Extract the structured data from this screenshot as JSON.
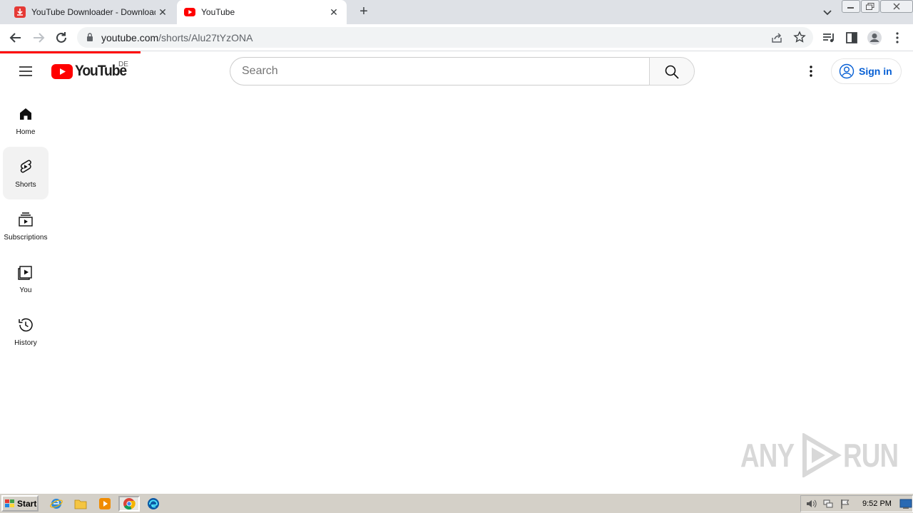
{
  "browser": {
    "tabs": [
      {
        "title": "YouTube Downloader - Download YouTube Videos",
        "active": false
      },
      {
        "title": "YouTube",
        "active": true
      }
    ],
    "address": {
      "host": "youtube.com",
      "path": "/shorts/Alu27tYzONA"
    }
  },
  "youtube": {
    "logo_text": "YouTube",
    "region": "DE",
    "search": {
      "placeholder": "Search"
    },
    "sign_in_label": "Sign in",
    "guide": [
      {
        "label": "Home",
        "icon": "home-icon"
      },
      {
        "label": "Shorts",
        "icon": "shorts-icon",
        "active": true
      },
      {
        "label": "Subscriptions",
        "icon": "subscriptions-icon"
      },
      {
        "label": "You",
        "icon": "you-icon"
      },
      {
        "label": "History",
        "icon": "history-icon"
      }
    ]
  },
  "watermark": {
    "text_left": "ANY",
    "text_right": "RUN"
  },
  "taskbar": {
    "start_label": "Start",
    "clock": "9:52 PM"
  },
  "colors": {
    "youtube_red": "#ff0000",
    "link_blue": "#065fd4",
    "tabstrip": "#dee1e6",
    "taskbar": "#d4d0c8"
  }
}
